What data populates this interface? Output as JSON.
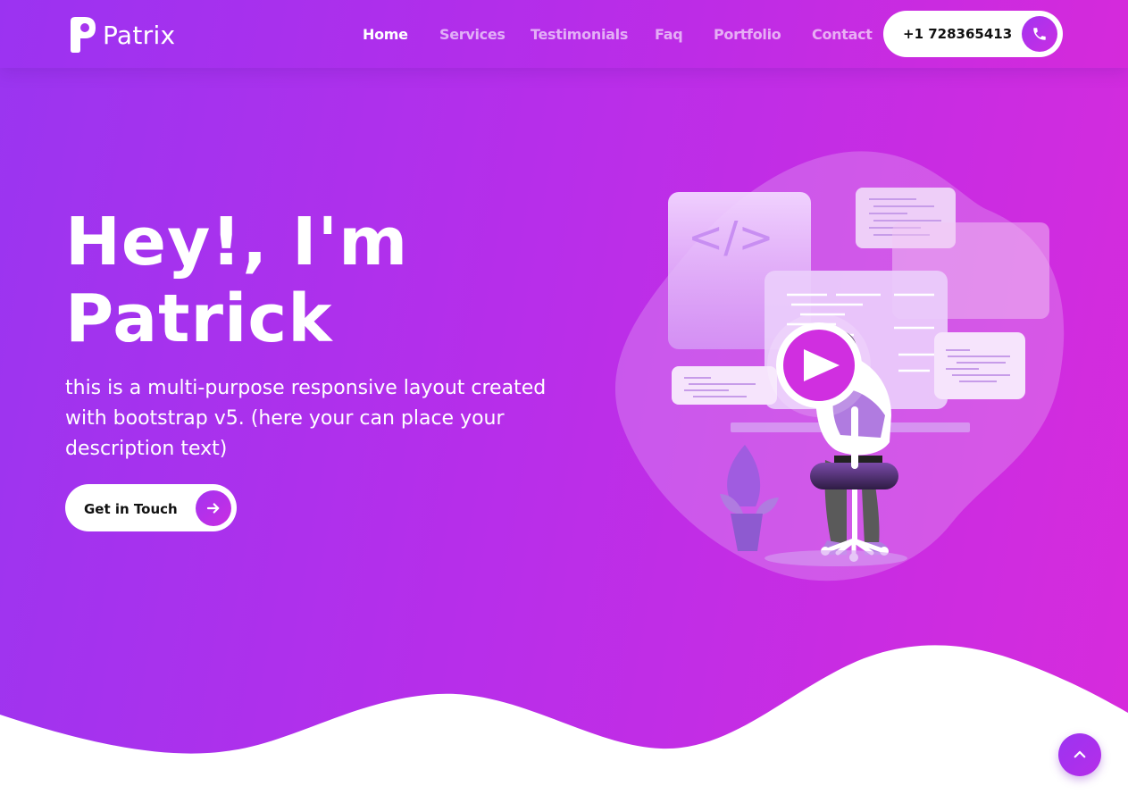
{
  "brand": {
    "name": "Patrix"
  },
  "nav": {
    "items": [
      {
        "label": "Home",
        "active": true
      },
      {
        "label": "Services",
        "active": false
      },
      {
        "label": "Testimonials",
        "active": false
      },
      {
        "label": "Faq",
        "active": false
      },
      {
        "label": "Portfolio",
        "active": false
      },
      {
        "label": "Contact",
        "active": false
      }
    ],
    "phone": "+1 728365413"
  },
  "hero": {
    "title_line1": "Hey!, I'm",
    "title_line2": "Patrick",
    "description": "this is a multi-purpose responsive layout created with bootstrap v5. (here your can place your description text)",
    "cta_label": "Get in Touch",
    "code_symbol": "</>"
  },
  "icons": {
    "phone": "phone-icon",
    "cta_arrow": "arrow-right-icon",
    "play": "play-icon",
    "scroll_top": "chevron-up-icon"
  },
  "colors": {
    "gradient_start": "#9a35f0",
    "gradient_end": "#d72bdc",
    "accent": "#a433f0",
    "white": "#ffffff"
  }
}
